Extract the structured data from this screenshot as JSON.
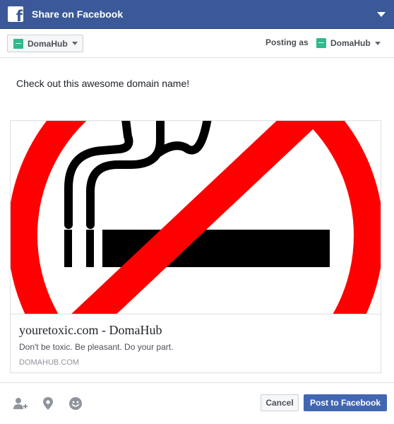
{
  "dialog": {
    "title": "Share on Facebook",
    "brand_color": "#3b5998"
  },
  "toolbar": {
    "audience_label": "DomaHub",
    "posting_as_label": "Posting as",
    "identity_label": "DomaHub",
    "brand_icon": "domahub-logo-icon",
    "brand_icon_color": "#2dba8c"
  },
  "post": {
    "message": "Check out this awesome domain name!"
  },
  "link_preview": {
    "image": "no-smoking-sign",
    "title": "youretoxic.com - DomaHub",
    "description": "Don't be toxic. Be pleasant. Do your part.",
    "domain": "DOMAHUB.COM"
  },
  "footer": {
    "icons": [
      "tag-friends-icon",
      "location-icon",
      "feeling-icon"
    ],
    "cancel_label": "Cancel",
    "post_label": "Post to Facebook",
    "post_color": "#4267b2"
  }
}
